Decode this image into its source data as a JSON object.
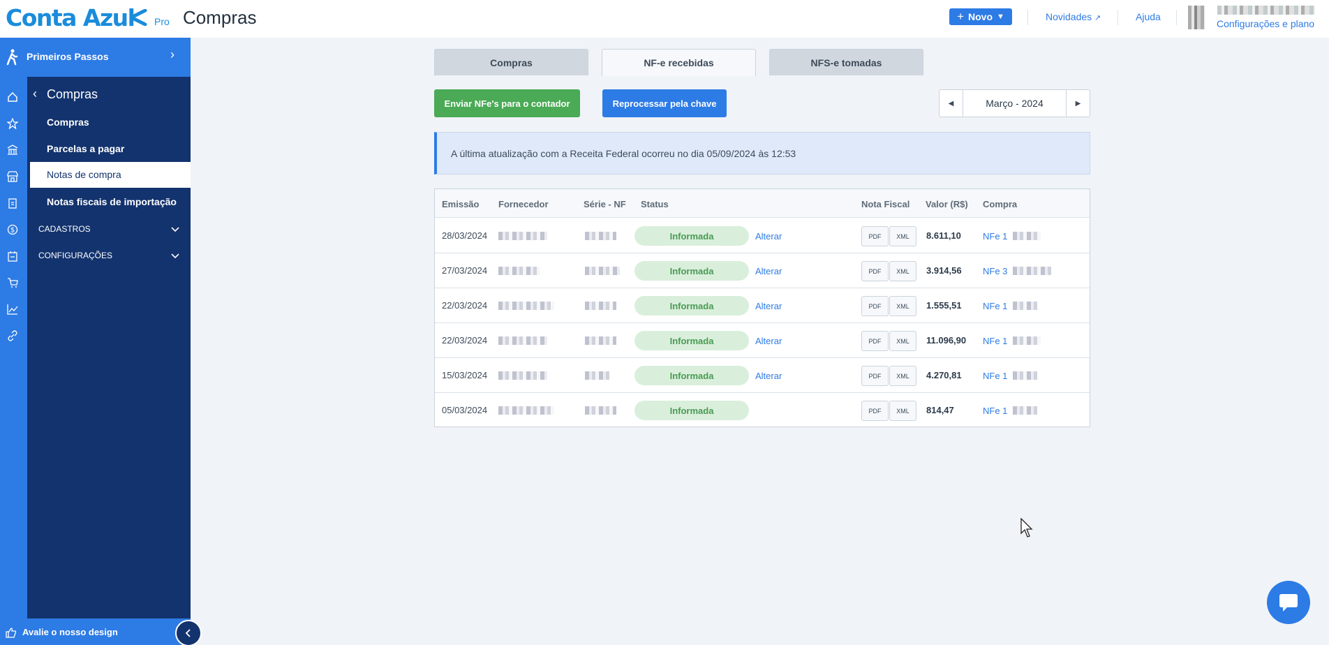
{
  "brand": {
    "logo_text": "Conta Azul",
    "plan": "Pro",
    "accent": "#2d7be5",
    "nav_dark": "#13336e"
  },
  "header": {
    "page_title": "Compras",
    "new_button": "Novo",
    "links": {
      "novidades": "Novidades",
      "ajuda": "Ajuda",
      "config": "Configurações e plano"
    }
  },
  "sidebar": {
    "onboarding": "Primeiros Passos",
    "section_title": "Compras",
    "items": [
      {
        "label": "Compras",
        "active": false
      },
      {
        "label": "Parcelas a pagar",
        "active": false
      },
      {
        "label": "Notas de compra",
        "active": true
      },
      {
        "label": "Notas fiscais de importação",
        "active": false
      }
    ],
    "groups": [
      {
        "label": "CADASTROS"
      },
      {
        "label": "CONFIGURAÇÕES"
      }
    ],
    "rail_icons": [
      "home-icon",
      "star-icon",
      "bank-icon",
      "store-icon",
      "clipboard-icon",
      "dollar-icon",
      "invoice-icon",
      "cart-icon",
      "chart-icon",
      "link-icon"
    ],
    "feedback": "Avalie o nosso design"
  },
  "tabs": [
    {
      "label": "Compras",
      "active": false
    },
    {
      "label": "NF-e recebidas",
      "active": true
    },
    {
      "label": "NFS-e tomadas",
      "active": false
    }
  ],
  "actions": {
    "send": "Enviar NFe's para o contador",
    "reprocess": "Reprocessar pela chave"
  },
  "period": {
    "label": "Março - 2024"
  },
  "banner": {
    "text": "A última atualização com a Receita Federal ocorreu no dia 05/09/2024 às 12:53"
  },
  "table": {
    "headers": {
      "emissao": "Emissão",
      "fornecedor": "Fornecedor",
      "serie": "Série - NF",
      "status": "Status",
      "nota": "Nota Fiscal",
      "valor": "Valor (R$)",
      "compra": "Compra"
    },
    "pdf": "PDF",
    "xml": "XML",
    "alterar": "Alterar",
    "rows": [
      {
        "date": "28/03/2024",
        "status": "Informada",
        "action": "Alterar",
        "valor": "8.611,10",
        "compra": "NFe 1"
      },
      {
        "date": "27/03/2024",
        "status": "Informada",
        "action": "Alterar",
        "valor": "3.914,56",
        "compra": "NFe 3"
      },
      {
        "date": "22/03/2024",
        "status": "Informada",
        "action": "Alterar",
        "valor": "1.555,51",
        "compra": "NFe 1"
      },
      {
        "date": "22/03/2024",
        "status": "Informada",
        "action": "Alterar",
        "valor": "11.096,90",
        "compra": "NFe 1"
      },
      {
        "date": "15/03/2024",
        "status": "Informada",
        "action": "Alterar",
        "valor": "4.270,81",
        "compra": "NFe 1"
      },
      {
        "date": "05/03/2024",
        "status": "Informada",
        "action": "",
        "valor": "814,47",
        "compra": "NFe 1"
      }
    ]
  }
}
